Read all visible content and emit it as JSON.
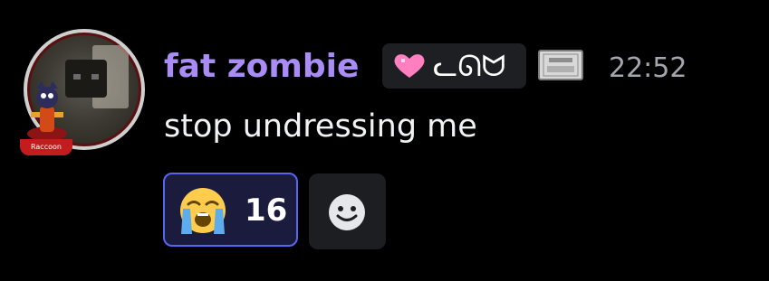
{
  "message": {
    "author": {
      "username": "fat zombie",
      "username_color": "#a98cf5",
      "avatar_icon": "zombie-avatar",
      "avatar_decoration_label": "Raccoon"
    },
    "clan_tag": {
      "badge_icon": "pink-heart-icon",
      "text": "ᓚᘏᗢ"
    },
    "profile_badge_icon": "ticket-icon",
    "timestamp": "22:52",
    "content": "stop undressing me"
  },
  "reactions": [
    {
      "emoji": "loudly-crying-face",
      "count": "16",
      "active": true,
      "accent": "#5865f2"
    }
  ],
  "add_reaction_icon": "smiley-face-icon"
}
